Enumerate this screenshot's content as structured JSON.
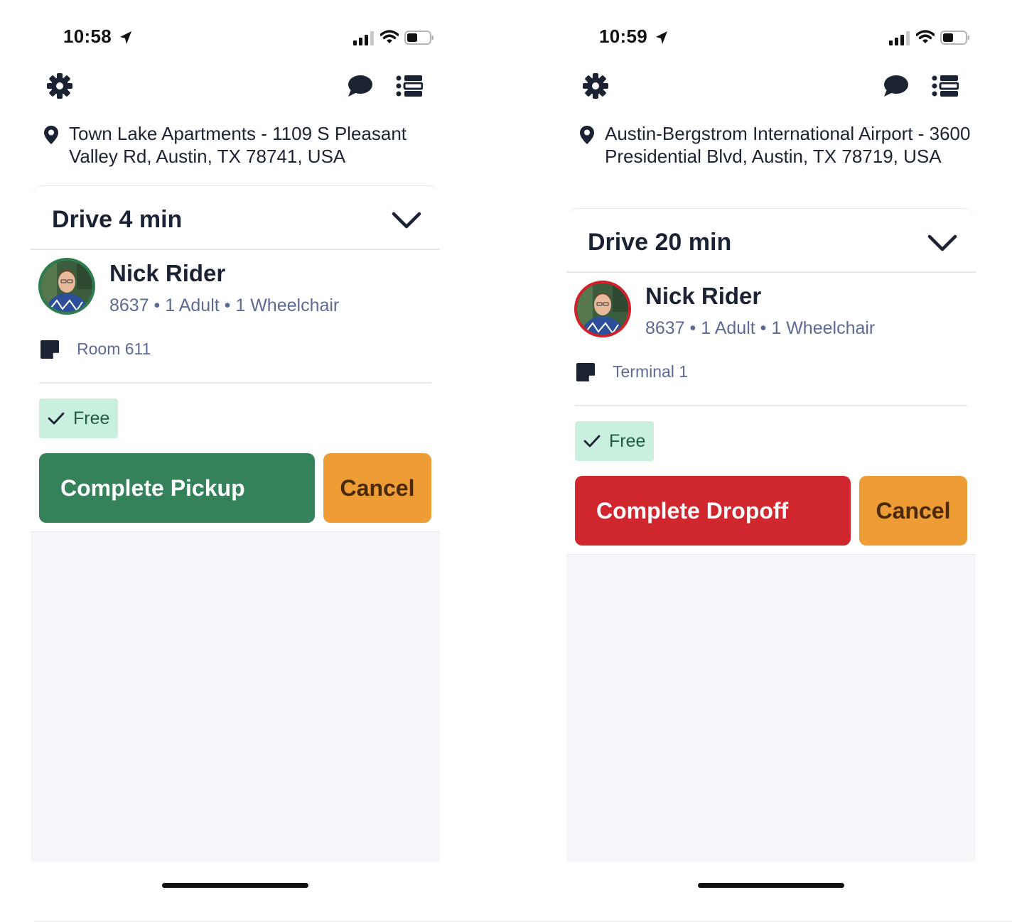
{
  "screens": [
    {
      "status": {
        "time": "10:58"
      },
      "address": "Town Lake Apartments - 1109 S Pleasant Valley Rd, Austin, TX 78741, USA",
      "drive_title": "Drive 4 min",
      "rider": {
        "name": "Nick Rider",
        "meta": "8637 • 1 Adult • 1 Wheelchair",
        "avatar_ring_color": "#2f7d4f"
      },
      "note": "Room 611",
      "fare": "Free",
      "primary_action": {
        "label": "Complete Pickup",
        "color": "#35815a"
      },
      "cancel_label": "Cancel"
    },
    {
      "status": {
        "time": "10:59"
      },
      "address": "Austin-Bergstrom International Airport - 3600 Presidential Blvd, Austin, TX 78719, USA",
      "drive_title": "Drive 20 min",
      "rider": {
        "name": "Nick Rider",
        "meta": "8637 • 1 Adult • 1 Wheelchair",
        "avatar_ring_color": "#d1212a"
      },
      "note": "Terminal 1",
      "fare": "Free",
      "primary_action": {
        "label": "Complete Dropoff",
        "color": "#d0262e"
      },
      "cancel_label": "Cancel"
    }
  ],
  "icons": {
    "toolbar": [
      "gear-icon",
      "chat-bubble-icon",
      "list-icon"
    ],
    "status": [
      "location-arrow-icon",
      "signal-icon",
      "wifi-icon",
      "battery-icon"
    ],
    "content": [
      "map-pin-icon",
      "chevron-down-icon",
      "note-icon",
      "checkmark-icon"
    ]
  },
  "colors": {
    "text_primary": "#1a2233",
    "text_secondary": "#5d6a96",
    "fare_badge_bg": "#c9f0df",
    "cancel_bg": "#ee9c35",
    "card_bg": "#f4f6fa"
  }
}
